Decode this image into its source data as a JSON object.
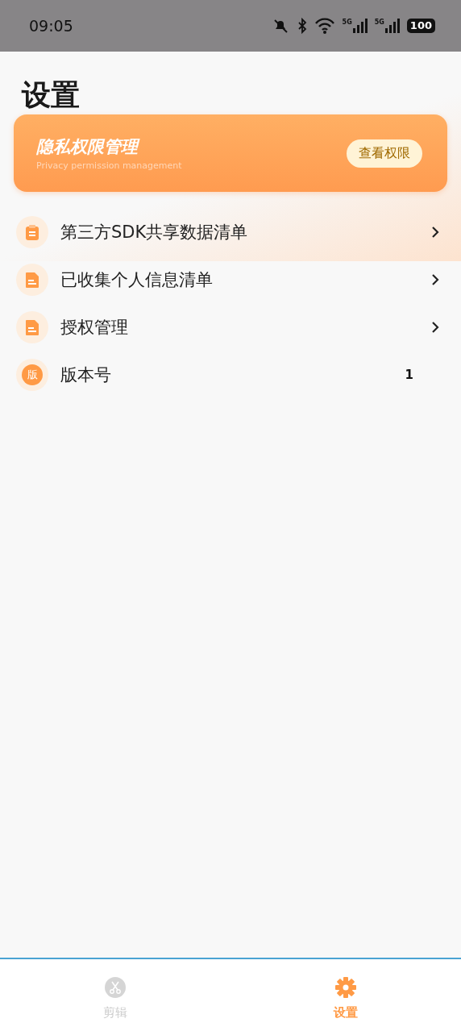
{
  "status_bar": {
    "time": "09:05",
    "battery": "100",
    "network_labels": [
      "5G",
      "5G"
    ]
  },
  "title": "设置",
  "privacy_card": {
    "title": "隐私权限管理",
    "subtitle": "Privacy permission management",
    "button": "查看权限"
  },
  "menu_items": [
    {
      "kind": "link",
      "label": "第三方SDK共享数据清单"
    },
    {
      "kind": "link",
      "label": "已收集个人信息清单"
    },
    {
      "kind": "link",
      "label": "授权管理"
    },
    {
      "kind": "value",
      "icon_text": "版",
      "label": "版本号",
      "value": "1"
    }
  ],
  "bottom_nav": [
    {
      "label": "剪辑",
      "selected": false
    },
    {
      "label": "设置",
      "selected": true
    }
  ]
}
